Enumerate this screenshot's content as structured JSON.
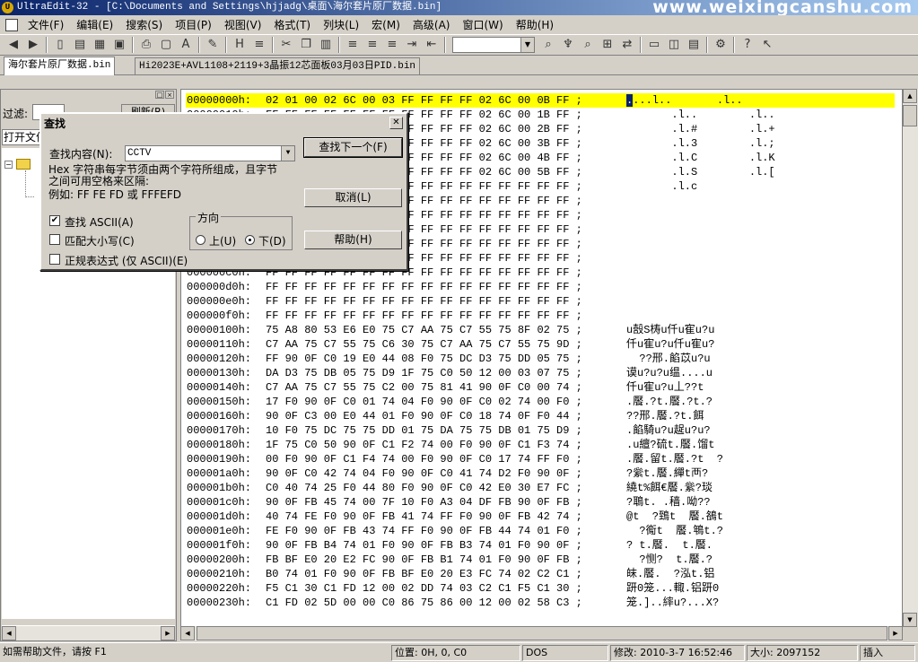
{
  "window": {
    "app_icon": "U",
    "title": "UltraEdit-32 - [C:\\Documents and Settings\\hjjadg\\桌面\\海尔套片原厂数据.bin]",
    "watermark": "www.weixingcanshu.com"
  },
  "menu": [
    "文件(F)",
    "编辑(E)",
    "搜索(S)",
    "项目(P)",
    "视图(V)",
    "格式(T)",
    "列块(L)",
    "宏(M)",
    "高级(A)",
    "窗口(W)",
    "帮助(H)"
  ],
  "toolbar": {
    "icons": [
      "back-icon",
      "forward-icon",
      "new-file-icon",
      "open-folder-icon",
      "open-icon",
      "save-icon",
      "print-icon",
      "print-preview-icon",
      "font-icon",
      "spell-icon",
      "hex-mode-icon",
      "word-wrap-icon",
      "cut-icon",
      "copy-icon",
      "paste-icon",
      "align-left-icon",
      "align-center-icon",
      "align-right-icon",
      "indent-icon",
      "outdent-icon",
      "find-icon",
      "find-chart-icon",
      "find-next-icon",
      "find-in-files-icon",
      "replace-icon",
      "window1-icon",
      "window2-icon",
      "window3-icon",
      "ftp-icon",
      "help-icon",
      "context-help-icon"
    ],
    "combo_value": ""
  },
  "tabs": [
    {
      "label": "海尔套片原厂数据.bin",
      "active": true
    },
    {
      "label": "Hi2023E+AVL1108+2119+3晶振12芯面板03月03日PID.bin",
      "active": false
    }
  ],
  "left_panel": {
    "filter_label": "过滤:",
    "filter_value": "",
    "refresh_label": "刷新(R)",
    "open_files_label": "打开文件"
  },
  "hex_rows": [
    {
      "addr": "00000000h:",
      "hex": "02 01 00 02 6C 00 03 FF FF FF FF 02 6C 00 0B FF ;",
      "ascii": "....l..       .l..",
      "highlight": true
    },
    {
      "addr": "00000010h:",
      "hex": "FF FF FF FF FF FF FF FF FF FF FF 02 6C 00 1B FF ;",
      "ascii": "       .l..        .l.."
    },
    {
      "addr": "00000020h:",
      "hex": "FF FF FF FF FF FF FF FF FF FF FF 02 6C 00 2B FF ;",
      "ascii": "       .l.#        .l.+"
    },
    {
      "addr": "00000030h:",
      "hex": "FF FF FF FF FF FF FF FF FF FF FF 02 6C 00 3B FF ;",
      "ascii": "       .l.3        .l.;"
    },
    {
      "addr": "00000040h:",
      "hex": "FF FF FF FF FF FF FF FF FF FF FF 02 6C 00 4B FF ;",
      "ascii": "       .l.C        .l.K"
    },
    {
      "addr": "00000050h:",
      "hex": "FF FF FF FF FF FF FF FF FF FF FF 02 6C 00 5B FF ;",
      "ascii": "       .l.S        .l.["
    },
    {
      "addr": "00000060h:",
      "hex": "FF FF FF FF FF FF FF FF FF FF FF FF FF FF FF FF ;",
      "ascii": "       .l.c"
    },
    {
      "addr": "00000070h:",
      "hex": "FF FF FF FF FF FF FF FF FF FF FF FF FF FF FF FF ;",
      "ascii": ""
    },
    {
      "addr": "00000080h:",
      "hex": "FF FF FF FF FF FF FF FF FF FF FF FF FF FF FF FF ;",
      "ascii": ""
    },
    {
      "addr": "00000090h:",
      "hex": "FF FF FF FF FF FF FF FF FF FF FF FF FF FF FF FF ;",
      "ascii": ""
    },
    {
      "addr": "000000a0h:",
      "hex": "FF FF FF FF FF FF FF FF FF FF FF FF FF FF FF FF ;",
      "ascii": ""
    },
    {
      "addr": "000000b0h:",
      "hex": "FF FF FF FF FF FF FF FF FF FF FF FF FF FF FF FF ;",
      "ascii": ""
    },
    {
      "addr": "000000c0h:",
      "hex": "FF FF FF FF FF FF FF FF FF FF FF FF FF FF FF FF ;",
      "ascii": ""
    },
    {
      "addr": "000000d0h:",
      "hex": "FF FF FF FF FF FF FF FF FF FF FF FF FF FF FF FF ;",
      "ascii": ""
    },
    {
      "addr": "000000e0h:",
      "hex": "FF FF FF FF FF FF FF FF FF FF FF FF FF FF FF FF ;",
      "ascii": ""
    },
    {
      "addr": "000000f0h:",
      "hex": "FF FF FF FF FF FF FF FF FF FF FF FF FF FF FF FF ;",
      "ascii": ""
    },
    {
      "addr": "00000100h:",
      "hex": "75 A8 80 53 E6 E0 75 C7 AA 75 C7 55 75 8F 02 75 ;",
      "ascii": "u嗀S梼u仟u寉u?u"
    },
    {
      "addr": "00000110h:",
      "hex": "C7 AA 75 C7 55 75 C6 30 75 C7 AA 75 C7 55 75 9D ;",
      "ascii": "仟u寉u?u仟u寉u?"
    },
    {
      "addr": "00000120h:",
      "hex": "FF 90 0F C0 19 E0 44 08 F0 75 DC D3 75 DD 05 75 ;",
      "ascii": "  ??邢.餡苡u?u"
    },
    {
      "addr": "00000130h:",
      "hex": "DA D3 75 DB 05 75 D9 1F 75 C0 50 12 00 03 07 75 ;",
      "ascii": "谟u?u?u缊....u"
    },
    {
      "addr": "00000140h:",
      "hex": "C7 AA 75 C7 55 75 C2 00 75 81 41 90 0F C0 00 74 ;",
      "ascii": "仟u寉u?u丄??t"
    },
    {
      "addr": "00000150h:",
      "hex": "17 F0 90 0F C0 01 74 04 F0 90 0F C0 02 74 00 F0 ;",
      "ascii": ".饜.?t.饜.?t.?"
    },
    {
      "addr": "00000160h:",
      "hex": "90 0F C3 00 E0 44 01 F0 90 0F C0 18 74 0F F0 44 ;",
      "ascii": "??邢.饜.?t.餌"
    },
    {
      "addr": "00000170h:",
      "hex": "10 F0 75 DC 75 75 DD 01 75 DA 75 75 DB 01 75 D9 ;",
      "ascii": ".餡騎u?u趗u?u?"
    },
    {
      "addr": "00000180h:",
      "hex": "1F 75 C0 50 90 0F C1 F2 74 00 F0 90 0F C1 F3 74 ;",
      "ascii": ".u繵?硫t.饜.馏t"
    },
    {
      "addr": "00000190h:",
      "hex": "00 F0 90 0F C1 F4 74 00 F0 90 0F C0 17 74 FF F0 ;",
      "ascii": ".饜.留t.饜.?t  ?"
    },
    {
      "addr": "000001a0h:",
      "hex": "90 0F C0 42 74 04 F0 90 0F C0 41 74 D2 F0 90 0F ;",
      "ascii": "?繠t.饜.繟t襾?"
    },
    {
      "addr": "000001b0h:",
      "hex": "C0 40 74 25 F0 44 80 F0 90 0F C0 42 E0 30 E7 FC ;",
      "ascii": "繞t%餌€饜.繠?琰"
    },
    {
      "addr": "000001c0h:",
      "hex": "90 0F FB 45 74 00 7F 10 F0 A3 04 DF FB 90 0F FB ;",
      "ascii": "?鵈t. .穑.呦??"
    },
    {
      "addr": "000001d0h:",
      "hex": "40 74 FE F0 90 0F FB 41 74 FF F0 90 0F FB 42 74 ;",
      "ascii": "@t  ?鵄t  饜.鵅t"
    },
    {
      "addr": "000001e0h:",
      "hex": "FE F0 90 0F FB 43 74 FF F0 90 0F FB 44 74 01 F0 ;",
      "ascii": "  ?鵆t  饜.鵇t.?"
    },
    {
      "addr": "000001f0h:",
      "hex": "90 0F FB B4 74 01 F0 90 0F FB B3 74 01 F0 90 0F ;",
      "ascii": "? t.饜.  t.饜."
    },
    {
      "addr": "00000200h:",
      "hex": "FB BF E0 20 E2 FC 90 0F FB B1 74 01 F0 90 0F FB ;",
      "ascii": "  ?恻?  t.饜.?"
    },
    {
      "addr": "00000210h:",
      "hex": "B0 74 01 F0 90 0F FB BF E0 20 E3 FC 74 02 C2 C1 ;",
      "ascii": "皌.饜.  ?泓t.铝"
    },
    {
      "addr": "00000220h:",
      "hex": "F5 C1 30 C1 FD 12 00 02 DD 74 03 C2 C1 F5 C1 30 ;",
      "ascii": "趼0笼...輙.铝趼0"
    },
    {
      "addr": "00000230h:",
      "hex": "C1 FD 02 5D 00 00 C0 86 75 86 00 12 00 02 58 C3 ;",
      "ascii": "笼.]..繂u?...X?"
    }
  ],
  "status": {
    "help": "如需帮助文件，请按 F1",
    "position": "位置: 0H, 0, C0",
    "format": "DOS",
    "modified": "修改: 2010-3-7 16:52:46",
    "size": "大小: 2097152",
    "mode": "插入"
  },
  "find_dialog": {
    "title": "查找",
    "find_label": "查找内容(N):",
    "find_value": "CCTV",
    "hint": "Hex 字符串每字节须由两个字符所组成，且字节之间可用空格来区隔:",
    "example": "例如: FF FE FD 或 FFFEFD",
    "find_next_label": "查找下一个(F)",
    "cancel_label": "取消(L)",
    "help_label": "帮助(H)",
    "opt_ascii": "查找 ASCII(A)",
    "opt_ascii_checked": true,
    "opt_case": "匹配大小写(C)",
    "opt_case_checked": false,
    "opt_regex": "正规表达式 (仅 ASCII)(E)",
    "opt_regex_checked": false,
    "direction_label": "方向",
    "dir_up": "上(U)",
    "dir_down": "下(D)",
    "direction": "down"
  }
}
